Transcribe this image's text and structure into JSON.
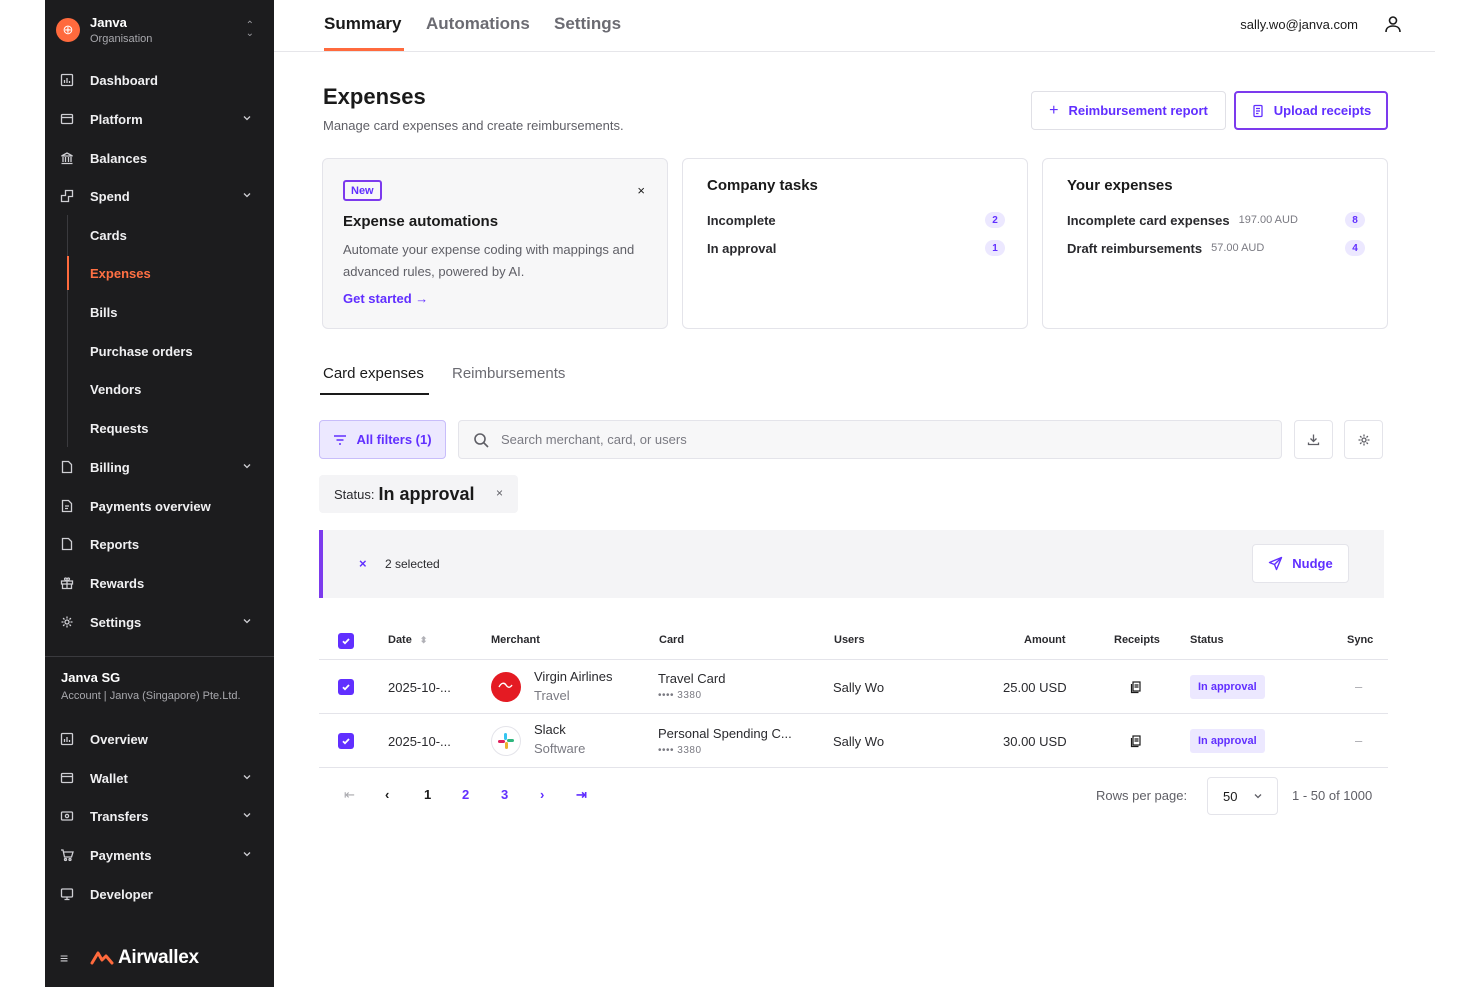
{
  "org": {
    "name": "Janva",
    "subtitle": "Organisation"
  },
  "sidebar": {
    "items": [
      {
        "label": "Dashboard",
        "icon": "dashboard-icon"
      },
      {
        "label": "Platform",
        "icon": "platform-icon"
      },
      {
        "label": "Balances",
        "icon": "bank-icon"
      },
      {
        "label": "Spend",
        "icon": "spend-icon"
      }
    ],
    "spend_sub": [
      "Cards",
      "Expenses",
      "Bills",
      "Purchase orders",
      "Vendors",
      "Requests"
    ],
    "items2": [
      {
        "label": "Billing",
        "icon": "billing-icon"
      },
      {
        "label": "Payments overview",
        "icon": "payments-overview-icon"
      },
      {
        "label": "Reports",
        "icon": "reports-icon"
      },
      {
        "label": "Rewards",
        "icon": "gift-icon"
      },
      {
        "label": "Settings",
        "icon": "gear-icon"
      }
    ],
    "account": {
      "name": "Janva SG",
      "subtitle": "Account | Janva (Singapore) Pte.Ltd."
    },
    "items3": [
      {
        "label": "Overview",
        "icon": "overview-icon"
      },
      {
        "label": "Wallet",
        "icon": "wallet-icon"
      },
      {
        "label": "Transfers",
        "icon": "transfers-icon"
      },
      {
        "label": "Payments",
        "icon": "cart-icon"
      },
      {
        "label": "Developer",
        "icon": "monitor-icon"
      }
    ],
    "brand": "Airwallex"
  },
  "topnav": {
    "tabs": [
      "Summary",
      "Automations",
      "Settings"
    ],
    "user_email": "sally.wo@janva.com"
  },
  "page": {
    "title": "Expenses",
    "subtitle": "Manage card expenses and create reimbursements.",
    "btn_reimbursement": "Reimbursement report",
    "btn_upload": "Upload receipts"
  },
  "promo": {
    "badge": "New",
    "close": "×",
    "title": "Expense automations",
    "description": "Automate your expense coding with mappings and advanced rules, powered by AI.",
    "link": "Get started →"
  },
  "company_tasks": {
    "title": "Company tasks",
    "rows": [
      {
        "label": "Incomplete",
        "count": "2"
      },
      {
        "label": "In approval",
        "count": "1"
      }
    ]
  },
  "your_expenses": {
    "title": "Your expenses",
    "rows": [
      {
        "label": "Incomplete card expenses",
        "amount": "197.00 AUD",
        "count": "8"
      },
      {
        "label": "Draft reimbursements",
        "amount": "57.00 AUD",
        "count": "4"
      }
    ]
  },
  "subtabs": [
    "Card expenses",
    "Reimbursements"
  ],
  "filters": {
    "all_filters": "All filters (1)",
    "search_placeholder": "Search merchant, card, or users",
    "chip_label": "Status:",
    "chip_value": "In approval",
    "chip_close": "×"
  },
  "selection": {
    "close": "×",
    "count_text": "2 selected",
    "nudge": "Nudge"
  },
  "table": {
    "columns": [
      "Date",
      "Merchant",
      "Card",
      "Users",
      "Amount",
      "Receipts",
      "Status",
      "Sync"
    ],
    "rows": [
      {
        "date": "2025-10-...",
        "merchant": "Virgin Airlines",
        "category": "Travel",
        "card": "Travel Card",
        "card_num": "•••• 3380",
        "user": "Sally Wo",
        "amount": "25.00 USD",
        "status": "In approval",
        "sync": "–"
      },
      {
        "date": "2025-10-...",
        "merchant": "Slack",
        "category": "Software",
        "card": "Personal Spending C...",
        "card_num": "•••• 3380",
        "user": "Sally Wo",
        "amount": "30.00 USD",
        "status": "In approval",
        "sync": "–"
      }
    ]
  },
  "pagination": {
    "first": "⇤",
    "prev": "‹",
    "pages": [
      "1",
      "2",
      "3"
    ],
    "next": "›",
    "last": "⇥",
    "rows_label": "Rows per page:",
    "rows_value": "50",
    "range": "1 - 50 of 1000"
  },
  "colors": {
    "accent": "#612fff",
    "brand": "#ff6a3d",
    "sidebar": "#1c1c1e"
  }
}
